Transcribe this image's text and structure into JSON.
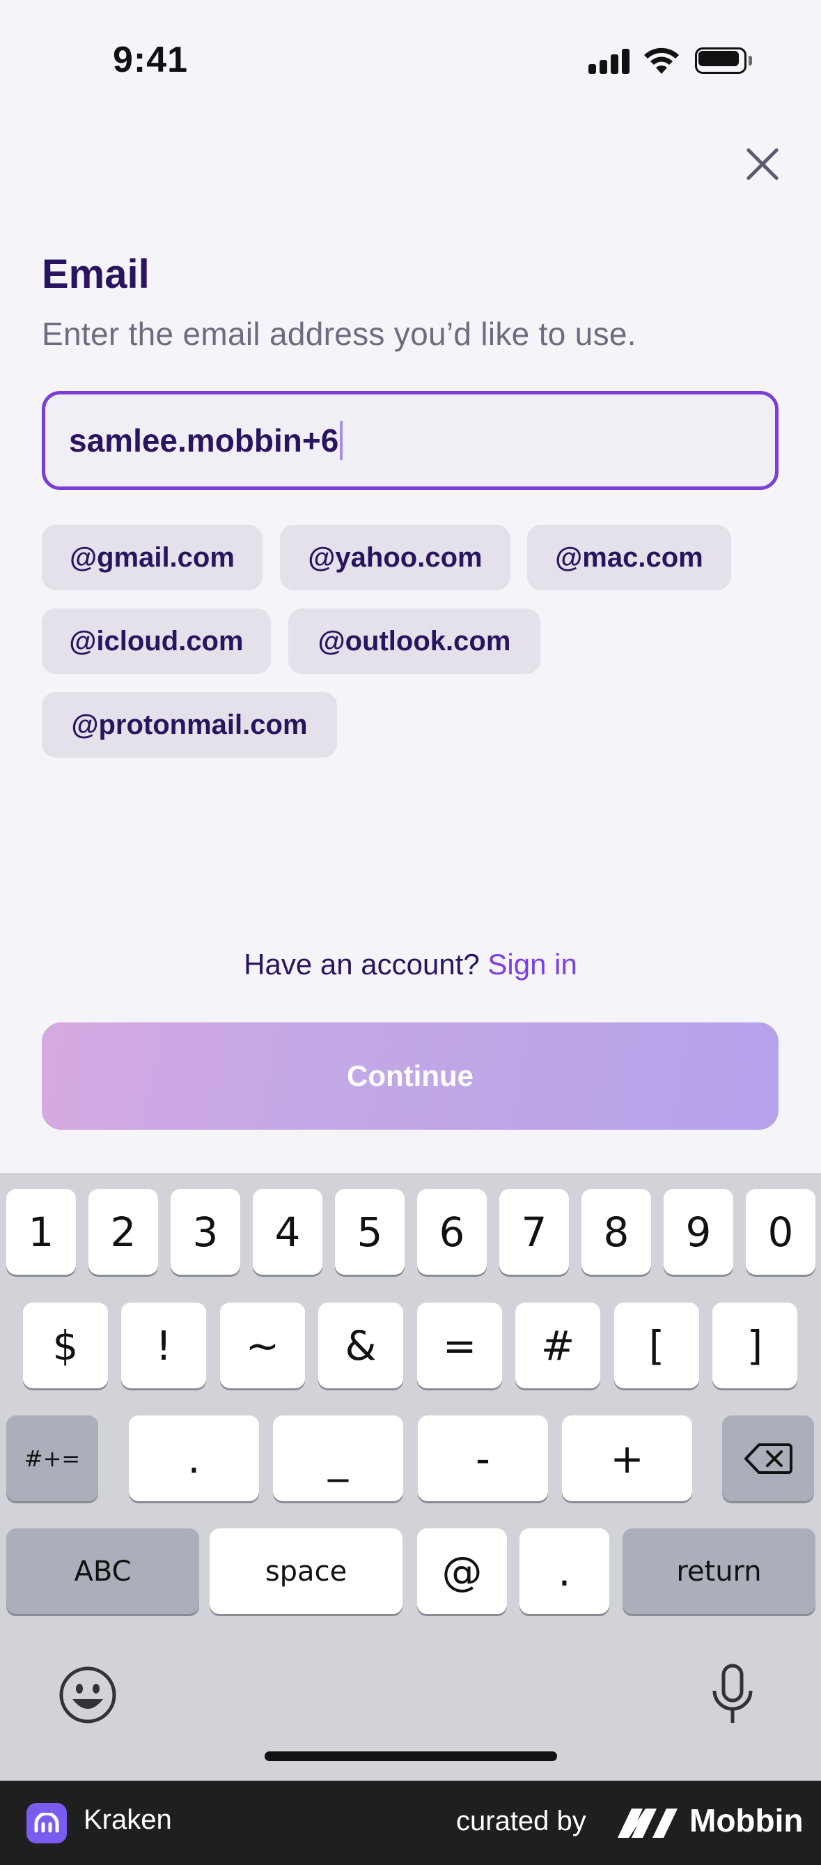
{
  "status_bar": {
    "time": "9:41"
  },
  "header": {
    "title": "Email",
    "subtitle": "Enter the email address you’d like to use."
  },
  "email_field": {
    "value": "samlee.mobbin+6"
  },
  "domain_suggestions": [
    "@gmail.com",
    "@yahoo.com",
    "@mac.com",
    "@icloud.com",
    "@outlook.com",
    "@protonmail.com"
  ],
  "signin": {
    "prompt": "Have an account?",
    "link": "Sign in"
  },
  "continue_button": {
    "label": "Continue"
  },
  "keyboard": {
    "row1": [
      "1",
      "2",
      "3",
      "4",
      "5",
      "6",
      "7",
      "8",
      "9",
      "0"
    ],
    "row2": [
      "$",
      "!",
      "~",
      "&",
      "=",
      "#",
      "[",
      "]"
    ],
    "row3": [
      ".",
      "_",
      "-",
      "+"
    ],
    "shift_label": "#+=",
    "abc_label": "ABC",
    "space_label": "space",
    "at_label": "@",
    "dot_label": ".",
    "return_label": "return"
  },
  "footer": {
    "app_name": "Kraken",
    "curated_by": "curated by",
    "brand": "Mobbin"
  },
  "colors": {
    "accent": "#7b3fe4",
    "title": "#2a1460",
    "field_border": "#7a3ed6",
    "continue_start": "#d6a9e2",
    "continue_end": "#b5a2ea"
  }
}
